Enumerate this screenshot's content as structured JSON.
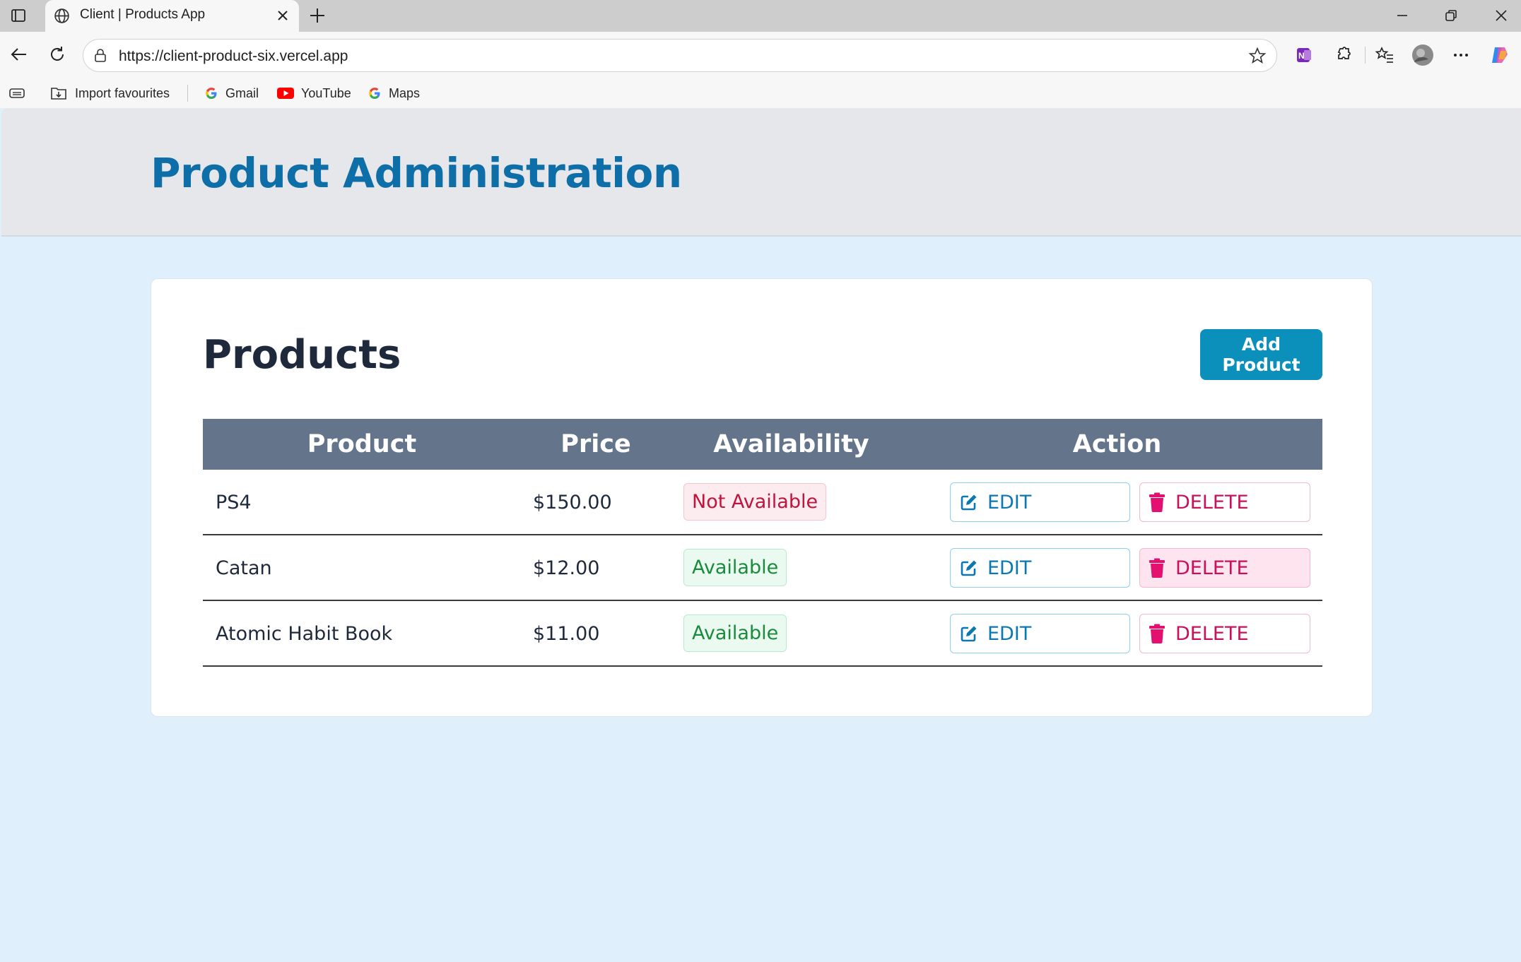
{
  "browser": {
    "tab_title": "Client | Products App",
    "url": "https://client-product-six.vercel.app",
    "bookmarks": [
      {
        "label": "Import favourites",
        "icon": "import-icon"
      },
      {
        "label": "Gmail",
        "icon": "google-icon"
      },
      {
        "label": "YouTube",
        "icon": "youtube-icon"
      },
      {
        "label": "Maps",
        "icon": "google-icon"
      }
    ]
  },
  "header": {
    "title": "Product Administration"
  },
  "products_card": {
    "title": "Products",
    "add_button": "Add Product",
    "columns": [
      "Product",
      "Price",
      "Availability",
      "Action"
    ],
    "rows": [
      {
        "name": "PS4",
        "price": "$150.00",
        "availability": "Not Available",
        "edit": "EDIT",
        "delete": "DELETE"
      },
      {
        "name": "Catan",
        "price": "$12.00",
        "availability": "Available",
        "edit": "EDIT",
        "delete": "DELETE"
      },
      {
        "name": "Atomic Habit Book",
        "price": "$11.00",
        "availability": "Available",
        "edit": "EDIT",
        "delete": "DELETE"
      }
    ]
  },
  "colors": {
    "header_title": "#0d6ea8",
    "add_button": "#0b8fbb",
    "table_header": "#64748b",
    "not_available": "#c0143c",
    "available": "#1b8a3b",
    "edit": "#0b78b3",
    "delete": "#c8115b",
    "page_bg": "#dfeffc"
  }
}
